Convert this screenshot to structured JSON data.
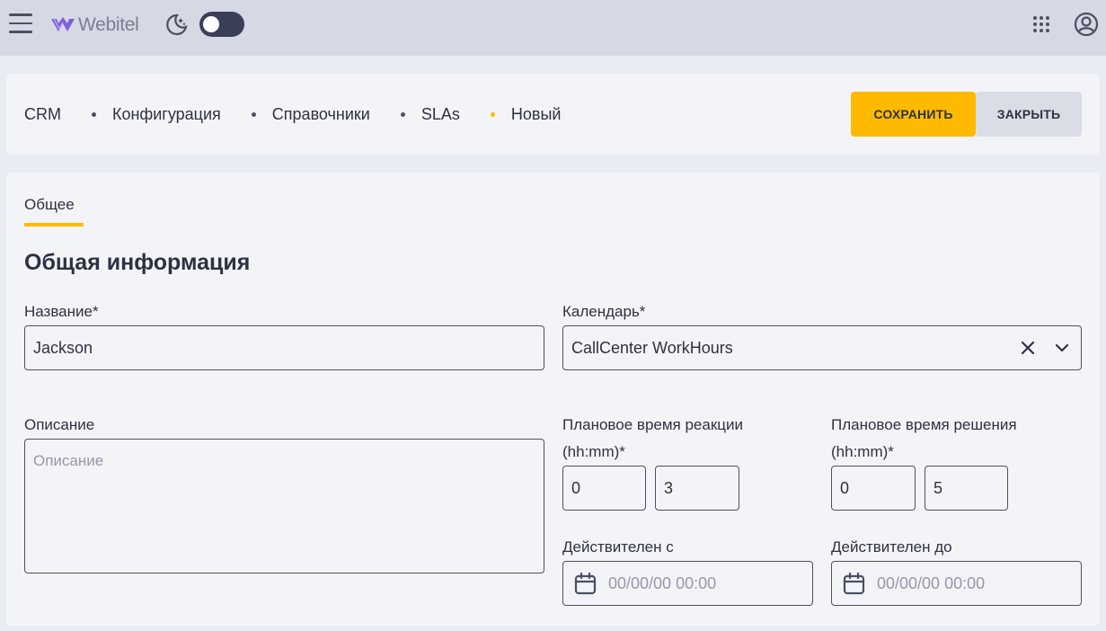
{
  "header": {
    "logo_text": "Webitel",
    "brand_color": "#7b5fe0",
    "icons": [
      "hamburger-menu-icon",
      "moon-icon",
      "apps-grid-icon",
      "user-account-icon"
    ]
  },
  "breadcrumb": {
    "items": [
      "CRM",
      "Конфигурация",
      "Справочники",
      "SLAs",
      "Новый"
    ]
  },
  "actions": {
    "save_label": "СОХРАНИТЬ",
    "close_label": "ЗАКРЫТЬ"
  },
  "tabs": [
    {
      "label": "Общее",
      "active": true
    }
  ],
  "section": {
    "title": "Общая информация"
  },
  "form": {
    "name": {
      "label": "Название*",
      "value": "Jackson"
    },
    "calendar": {
      "label": "Календарь*",
      "value": "CallCenter WorkHours"
    },
    "description": {
      "label": "Описание",
      "placeholder": "Описание",
      "value": ""
    },
    "reaction_time": {
      "label_line1": "Плановое время реакции",
      "label_line2": "(hh:mm)*",
      "hours": "0",
      "minutes": "3"
    },
    "resolution_time": {
      "label_line1": "Плановое время решения",
      "label_line2": "(hh:mm)*",
      "hours": "0",
      "minutes": "5"
    },
    "valid_from": {
      "label": "Действителен с",
      "placeholder": "00/00/00 00:00"
    },
    "valid_to": {
      "label": "Действителен до",
      "placeholder": "00/00/00 00:00"
    }
  },
  "colors": {
    "accent": "#ffba00",
    "header_bg": "#d6d9e3",
    "card_bg": "#f3f4f8",
    "text": "#2d3142"
  }
}
